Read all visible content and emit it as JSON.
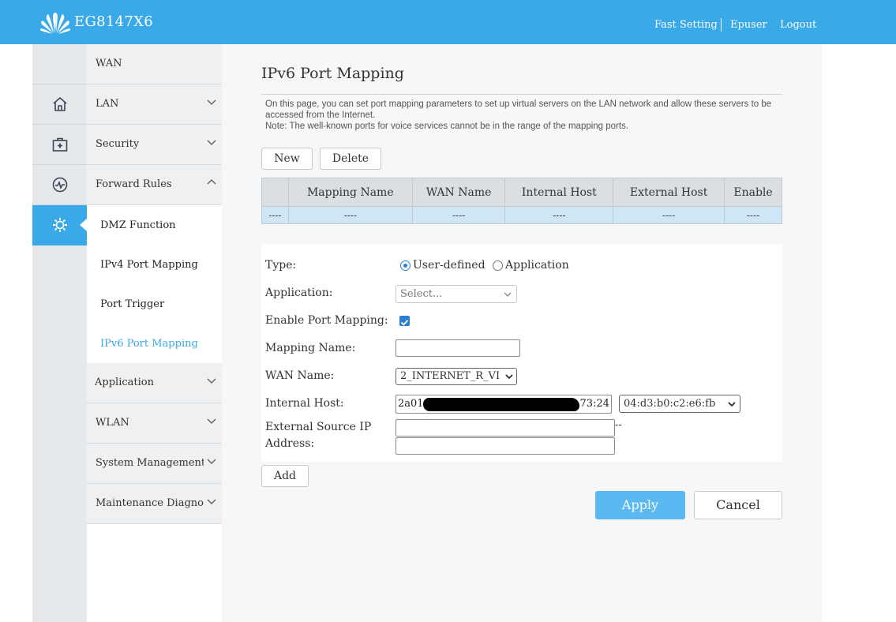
{
  "header": {
    "model": "EG8147X6",
    "links": {
      "fast_setting": "Fast Setting",
      "user": "Epuser",
      "logout": "Logout"
    }
  },
  "menu": {
    "wan": "WAN",
    "lan": "LAN",
    "security": "Security",
    "forward_rules": "Forward Rules",
    "submenu": [
      "DMZ Function",
      "IPv4 Port Mapping",
      "Port Trigger",
      "IPv6 Port Mapping"
    ],
    "application": "Application",
    "wlan": "WLAN",
    "system_management": "System Management",
    "maintenance": "Maintenance Diagnosis"
  },
  "page": {
    "title": "IPv6 Port Mapping",
    "description": "On this page, you can set port mapping parameters to set up virtual servers on the LAN network and allow these servers to be accessed from the Internet.",
    "note": "Note: The well-known ports for voice services cannot be in the range of the mapping ports.",
    "new_button": "New",
    "delete_button": "Delete"
  },
  "table": {
    "headers": [
      "",
      "Mapping Name",
      "WAN Name",
      "Internal Host",
      "External Host",
      "Enable"
    ],
    "rows": [
      [
        "----",
        "----",
        "----",
        "----",
        "----",
        "----"
      ]
    ]
  },
  "form": {
    "type_label": "Type:",
    "type_options": [
      "User-defined",
      "Application"
    ],
    "type_selected": "User-defined",
    "application_label": "Application:",
    "application_value": "Select...",
    "enable_label": "Enable Port Mapping:",
    "enable_checked": true,
    "mapping_name_label": "Mapping Name:",
    "mapping_name_value": "",
    "wan_name_label": "WAN Name:",
    "wan_name_value": "2_INTERNET_R_VI",
    "internal_host_label": "Internal Host:",
    "internal_host_value_start": "2a01",
    "internal_host_value_end": "73:24",
    "internal_host_mac": "04:d3:b0:c2:e6:fb",
    "external_source_label": "External Source IP Address:",
    "range_separator": "--",
    "add_button": "Add"
  },
  "actions": {
    "apply": "Apply",
    "cancel": "Cancel"
  },
  "colors": {
    "brand": "#3aa9e8",
    "apply_bg": "#5cb8f0",
    "selected_row": "#cfe6f7"
  },
  "icons": [
    "huawei-logo",
    "home-icon",
    "medical-kit-icon",
    "diagnosis-icon",
    "gear-icon",
    "chevron-down-icon",
    "chevron-up-icon"
  ]
}
